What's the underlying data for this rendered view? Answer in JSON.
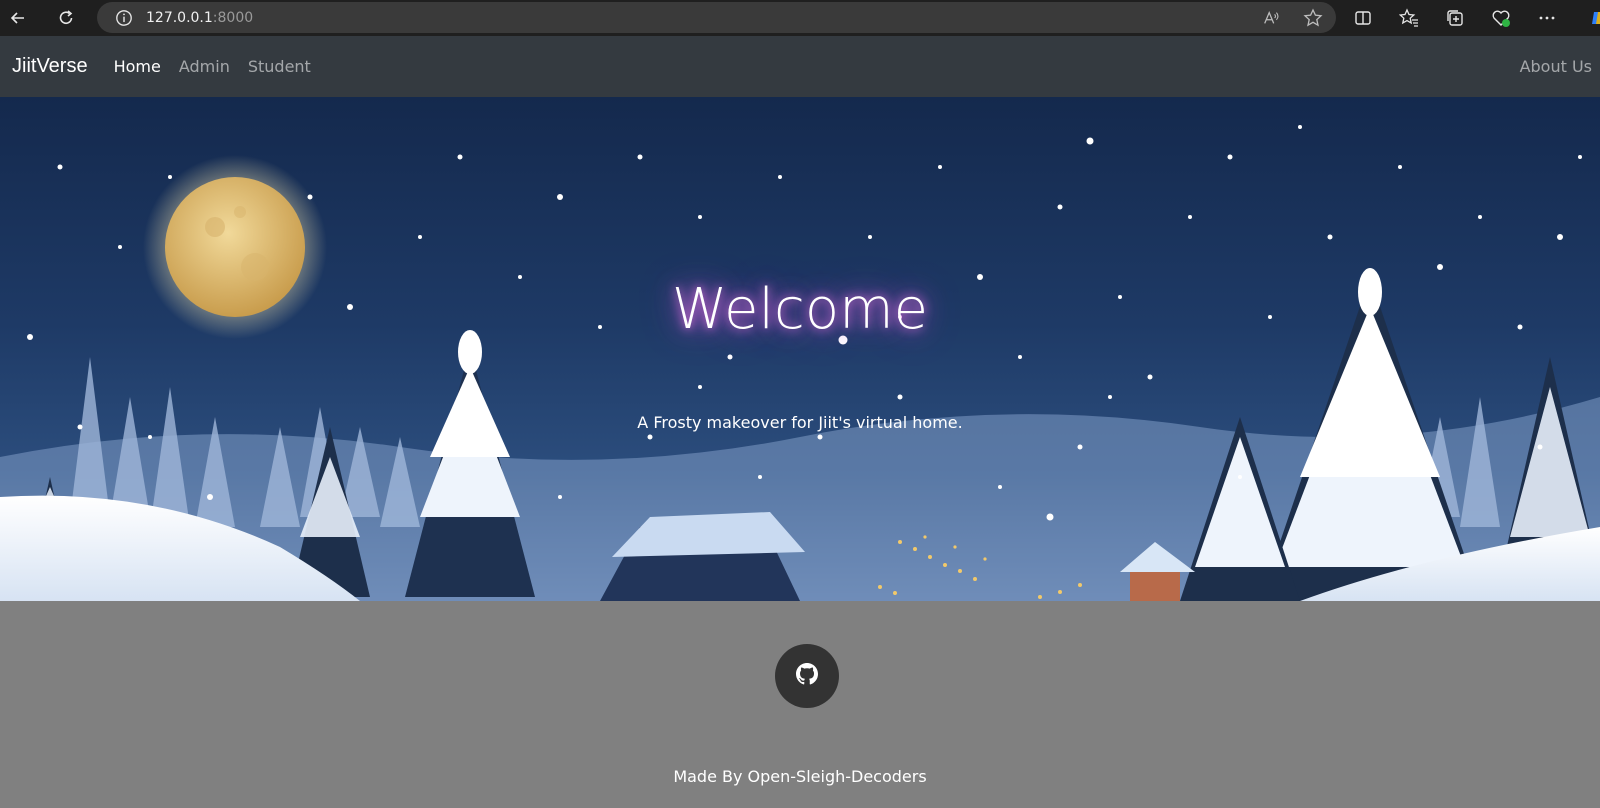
{
  "browser": {
    "url_host": "127.0.0.1",
    "url_port": ":8000"
  },
  "navbar": {
    "brand": "JiitVerse",
    "links": [
      {
        "label": "Home",
        "active": true
      },
      {
        "label": "Admin",
        "active": false
      },
      {
        "label": "Student",
        "active": false
      }
    ],
    "right_link": "About Us"
  },
  "hero": {
    "title": "Welcome",
    "subtitle": "A Frosty makeover for Jiit's virtual home."
  },
  "footer": {
    "github_icon": "github-icon",
    "credit": "Made By Open-Sleigh-Decoders"
  },
  "colors": {
    "navbar_bg": "#343a40",
    "footer_bg": "#808080",
    "github_button_bg": "#333333",
    "title_glow": "#c05cd8"
  }
}
